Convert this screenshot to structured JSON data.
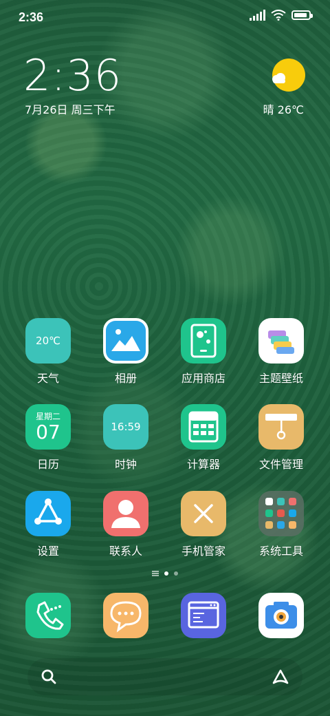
{
  "status_bar": {
    "time": "2:36",
    "battery_level": 0.9
  },
  "lock_widget": {
    "clock": "2:36",
    "date": "7月26日 周三下午",
    "weather": "晴 26℃",
    "weather_icon": "sun-cloud-icon"
  },
  "apps": [
    {
      "label": "天气",
      "icon": "weather-icon",
      "text": "20℃",
      "color": "#3cc3b9"
    },
    {
      "label": "相册",
      "icon": "gallery-icon",
      "color": "#2aa8e8"
    },
    {
      "label": "应用商店",
      "icon": "app-store-icon",
      "color": "#1fc48c"
    },
    {
      "label": "主题壁纸",
      "icon": "theme-icon",
      "color": "#ffffff"
    },
    {
      "label": "日历",
      "icon": "calendar-icon",
      "text_top": "星期二",
      "text": "07",
      "color": "#1fc48c"
    },
    {
      "label": "时钟",
      "icon": "clock-icon",
      "text": "16:59",
      "color": "#3cc3b9"
    },
    {
      "label": "计算器",
      "icon": "calculator-icon",
      "color": "#1fc48c"
    },
    {
      "label": "文件管理",
      "icon": "file-manager-icon",
      "color": "#e8b96a"
    },
    {
      "label": "设置",
      "icon": "settings-icon",
      "color": "#1aa8ec"
    },
    {
      "label": "联系人",
      "icon": "contacts-icon",
      "color": "#f0706e"
    },
    {
      "label": "手机管家",
      "icon": "phone-manager-icon",
      "color": "#e8b96a"
    },
    {
      "label": "系统工具",
      "icon": "folder-icon",
      "color": "#5b6b62"
    }
  ],
  "dock": [
    {
      "icon": "phone-icon",
      "color": "#1fc48c"
    },
    {
      "icon": "messages-icon",
      "color": "#f7b76a"
    },
    {
      "icon": "browser-icon",
      "color": "#5965e0"
    },
    {
      "icon": "camera-icon",
      "color": "#ffffff"
    }
  ]
}
